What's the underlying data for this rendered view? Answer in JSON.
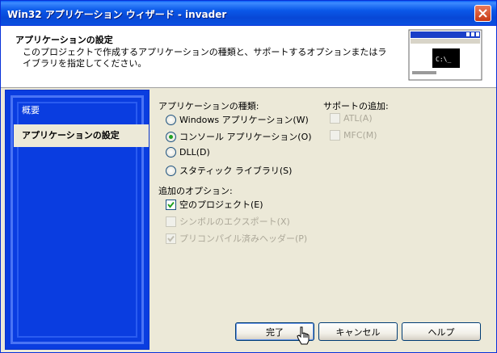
{
  "window": {
    "title": "Win32 アプリケーション ウィザード - invader"
  },
  "header": {
    "title": "アプリケーションの設定",
    "description": "このプロジェクトで作成するアプリケーションの種類と、サポートするオプションまたはライブラリを指定してください。",
    "console_icon_text": "C:\\_"
  },
  "sidebar": {
    "items": [
      {
        "label": "概要"
      },
      {
        "label": "アプリケーションの設定"
      }
    ]
  },
  "app_type": {
    "label": "アプリケーションの種類:",
    "selected": "コンソール アプリケーション(O)",
    "options": [
      "Windows アプリケーション(W)",
      "コンソール アプリケーション(O)",
      "DLL(D)",
      "スタティック ライブラリ(S)"
    ]
  },
  "support": {
    "label": "サポートの追加:",
    "options": [
      "ATL(A)",
      "MFC(M)"
    ]
  },
  "additional": {
    "label": "追加のオプション:",
    "options": [
      {
        "label": "空のプロジェクト(E)",
        "checked": true,
        "enabled": true
      },
      {
        "label": "シンボルのエクスポート(X)",
        "checked": false,
        "enabled": false
      },
      {
        "label": "プリコンパイル済みヘッダー(P)",
        "checked": true,
        "enabled": false
      }
    ]
  },
  "buttons": {
    "finish": "完了",
    "cancel": "キャンセル",
    "help": "ヘルプ"
  }
}
